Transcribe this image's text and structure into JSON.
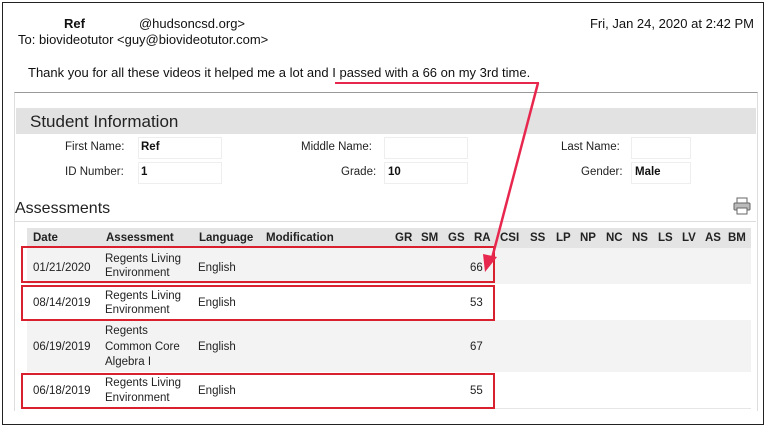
{
  "email": {
    "from_name": "Ref",
    "from_domain": "@hudsoncsd.org>",
    "to_line": "To: biovideotutor <guy@biovideotutor.com>",
    "datetime": "Fri, Jan 24, 2020 at 2:42 PM",
    "body": "Thank you for all these videos it helped me a lot and I passed with a 66 on my 3rd time."
  },
  "student": {
    "section_title": "Student Information",
    "first_name_label": "First Name:",
    "first_name": "Ref",
    "middle_name_label": "Middle Name:",
    "last_name_label": "Last Name:",
    "id_label": "ID Number:",
    "id_value": "1",
    "grade_label": "Grade:",
    "grade_value": "10",
    "gender_label": "Gender:",
    "gender_value": "Male"
  },
  "assessments": {
    "title": "Assessments",
    "columns": [
      "Date",
      "Assessment",
      "Language",
      "Modification",
      "GR",
      "SM",
      "GS",
      "RA",
      "CSI",
      "SS",
      "LP",
      "NP",
      "NC",
      "NS",
      "LS",
      "LV",
      "AS",
      "BM"
    ],
    "rows": [
      {
        "date": "01/21/2020",
        "assessment": [
          "Regents Living",
          "Environment"
        ],
        "language": "English",
        "score": "66"
      },
      {
        "date": "08/14/2019",
        "assessment": [
          "Regents Living",
          "Environment"
        ],
        "language": "English",
        "score": "53"
      },
      {
        "date": "06/19/2019",
        "assessment": [
          "Regents",
          "Common Core",
          "Algebra I"
        ],
        "language": "English",
        "score": "67"
      },
      {
        "date": "06/18/2019",
        "assessment": [
          "Regents Living",
          "Environment"
        ],
        "language": "English",
        "score": "55"
      }
    ]
  },
  "colors": {
    "annotation": "#e8274f",
    "highlight_box": "#d8202e",
    "header_bg": "#e2e2e2"
  },
  "icons": {
    "print": "printer-icon"
  }
}
